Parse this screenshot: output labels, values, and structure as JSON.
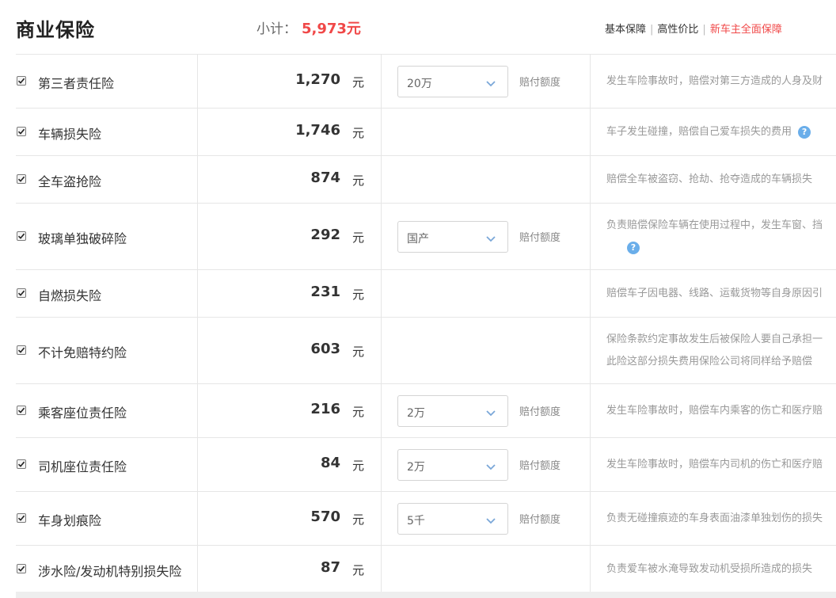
{
  "header": {
    "title": "商业保险",
    "subtotal_label": "小计：",
    "subtotal_value": "5,973元",
    "plans": [
      "基本保障",
      "高性价比",
      "新车主全面保障"
    ]
  },
  "unit": "元",
  "coverage_label": "赔付额度",
  "rows": [
    {
      "name": "第三者责任险",
      "price": "1,270",
      "checked": true,
      "select": "20万",
      "desc1": "发生车险事故时，赔偿对第三方造成的人身及财",
      "desc2": ""
    },
    {
      "name": "车辆损失险",
      "price": "1,746",
      "checked": true,
      "select": "",
      "desc1": "车子发生碰撞，赔偿自己爱车损失的费用",
      "desc2": ""
    },
    {
      "name": "全车盗抢险",
      "price": "874",
      "checked": true,
      "select": "",
      "desc1": "赔偿全车被盗窃、抢劫、抢夺造成的车辆损失",
      "desc2": ""
    },
    {
      "name": "玻璃单独破碎险",
      "price": "292",
      "checked": true,
      "select": "国产",
      "desc1": "负责赔偿保险车辆在使用过程中，发生车窗、挡",
      "desc2": ""
    },
    {
      "name": "自燃损失险",
      "price": "231",
      "checked": true,
      "select": "",
      "desc1": "赔偿车子因电器、线路、运载货物等自身原因引",
      "desc2": ""
    },
    {
      "name": "不计免赔特约险",
      "price": "603",
      "checked": true,
      "select": "",
      "desc1": "保险条款约定事故发生后被保险人要自己承担一",
      "desc2": "此险这部分损失费用保险公司将同样给予赔偿"
    },
    {
      "name": "乘客座位责任险",
      "price": "216",
      "checked": true,
      "select": "2万",
      "desc1": "发生车险事故时，赔偿车内乘客的伤亡和医疗赔",
      "desc2": ""
    },
    {
      "name": "司机座位责任险",
      "price": "84",
      "checked": true,
      "select": "2万",
      "desc1": "发生车险事故时，赔偿车内司机的伤亡和医疗赔",
      "desc2": ""
    },
    {
      "name": "车身划痕险",
      "price": "570",
      "checked": true,
      "select": "5千",
      "desc1": "负责无碰撞痕迹的车身表面油漆单独划伤的损失",
      "desc2": ""
    },
    {
      "name": "涉水险/发动机特别损失险",
      "price": "87",
      "checked": true,
      "select": "",
      "desc1": "负责爱车被水淹导致发动机受损所造成的损失",
      "desc2": ""
    }
  ],
  "colors": {
    "accent_red": "#f04848",
    "help_blue": "#6aaeea"
  },
  "icons": {
    "checkbox": "checkbox-checked-icon",
    "select": "chevron-down-icon",
    "help": "question-mark-icon"
  }
}
